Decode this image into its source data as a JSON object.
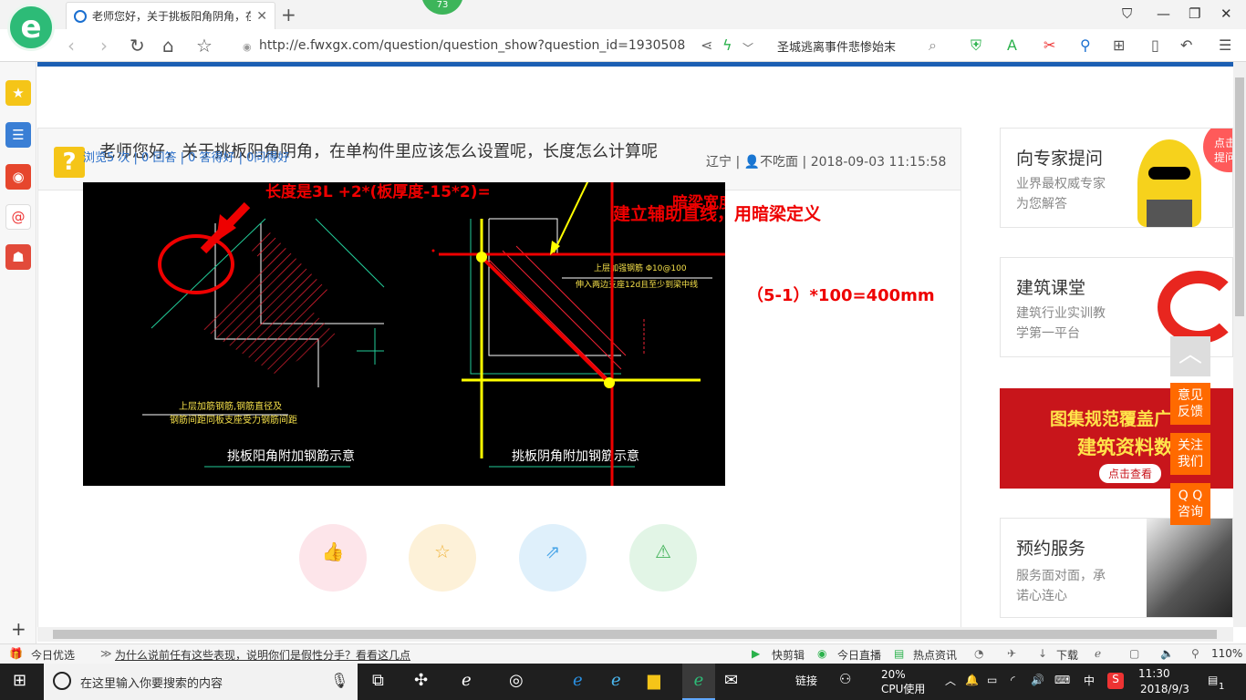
{
  "browser": {
    "tab_title": "老师您好，关于挑板阳角阴角，在",
    "badge": "73",
    "url": "http://e.fwxgx.com/question/question_show?question_id=1930508",
    "search_text": "圣城逃离事件悲惨始末"
  },
  "question": {
    "title": "老师您好，关于挑板阳角阴角，在单构件里应该怎么设置呢，长度怎么计算呢",
    "region": "辽宁",
    "user": "不吃面",
    "time": "2018-09-03 11:15:58",
    "stats": "浏览5 次 | 0 回答 | 0 答得好 | 0问得好"
  },
  "image": {
    "note_length": "长度是3L +2*(板厚度-15*2)=",
    "note_aux": "建立辅助直线，用暗梁定义",
    "note_width": "暗梁宽度按照400mm",
    "note_calc": "（5-1）*100=400mm",
    "left_caption": "挑板阳角附加钢筋示意",
    "right_caption": "挑板阴角附加钢筋示意",
    "left_note1": "上层加筋钢筋,钢筋直径及",
    "left_note2": "钢筋间距同板支座受力钢筋间距",
    "right_note1": "上层加强钢筋 Φ10@100",
    "right_note2": "伸入两边支座12d且至少到梁中线"
  },
  "sidebar": {
    "expert_title": "向专家提问",
    "expert_desc1": "业界最权威专家",
    "expert_desc2": "为您解答",
    "expert_bubble1": "点击",
    "expert_bubble2": "提问",
    "course_title": "建筑课堂",
    "course_desc1": "建筑行业实训教",
    "course_desc2": "学第一平台",
    "banner_line1": "图集规范覆盖广",
    "banner_line2": "建筑资料数",
    "banner_btn": "点击查看",
    "service_title": "预约服务",
    "service_desc1": "服务面对面，承",
    "service_desc2": "诺心连心"
  },
  "float": {
    "feedback1": "意见",
    "feedback2": "反馈",
    "follow1": "关注",
    "follow2": "我们",
    "qq1": "Q Q",
    "qq2": "咨询"
  },
  "status": {
    "today": "今日优选",
    "headline": "为什么说前任有这些表现，说明你们是假性分手？看看这几点",
    "clip": "快剪辑",
    "live": "今日直播",
    "news": "热点资讯",
    "download": "下载",
    "zoom": "110%"
  },
  "taskbar": {
    "search_placeholder": "在这里输入你要搜索的内容",
    "link": "链接",
    "cpu_pct": "20%",
    "cpu_label": "CPU使用",
    "ime": "中",
    "time": "11:30",
    "date": "2018/9/3",
    "notif": "1"
  }
}
